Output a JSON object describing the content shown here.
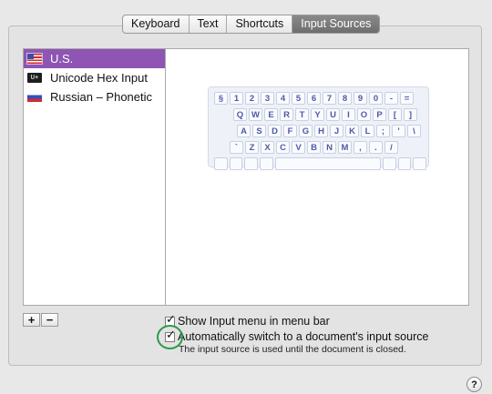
{
  "tabs": [
    {
      "label": "Keyboard"
    },
    {
      "label": "Text"
    },
    {
      "label": "Shortcuts"
    },
    {
      "label": "Input Sources"
    }
  ],
  "selected_tab": "Input Sources",
  "input_sources": [
    {
      "label": "U.S.",
      "flag": "us-flag-icon",
      "selected": true
    },
    {
      "label": "Unicode Hex Input",
      "flag": "unicode-hex-icon",
      "selected": false
    },
    {
      "label": "Russian – Phonetic",
      "flag": "russian-flag-icon",
      "selected": false
    }
  ],
  "keyboard": {
    "row1": [
      "§",
      "1",
      "2",
      "3",
      "4",
      "5",
      "6",
      "7",
      "8",
      "9",
      "0",
      "-",
      "="
    ],
    "row2": [
      "Q",
      "W",
      "E",
      "R",
      "T",
      "Y",
      "U",
      "I",
      "O",
      "P",
      "[",
      "]"
    ],
    "row3": [
      "A",
      "S",
      "D",
      "F",
      "G",
      "H",
      "J",
      "K",
      "L",
      ";",
      "'",
      "\\"
    ],
    "row4": [
      "`",
      "Z",
      "X",
      "C",
      "V",
      "B",
      "N",
      "M",
      ",",
      ".",
      "/"
    ]
  },
  "buttons": {
    "add": "+",
    "remove": "−",
    "help": "?"
  },
  "options": {
    "show_menu_label": "Show Input menu in menu bar",
    "auto_switch_label": "Automatically switch to a document's input source",
    "auto_switch_note": "The input source is used until the document is closed."
  },
  "colors": {
    "selection": "#8e55b4",
    "highlight_circle": "#2a9a4a",
    "key_text": "#4f5aa8"
  }
}
